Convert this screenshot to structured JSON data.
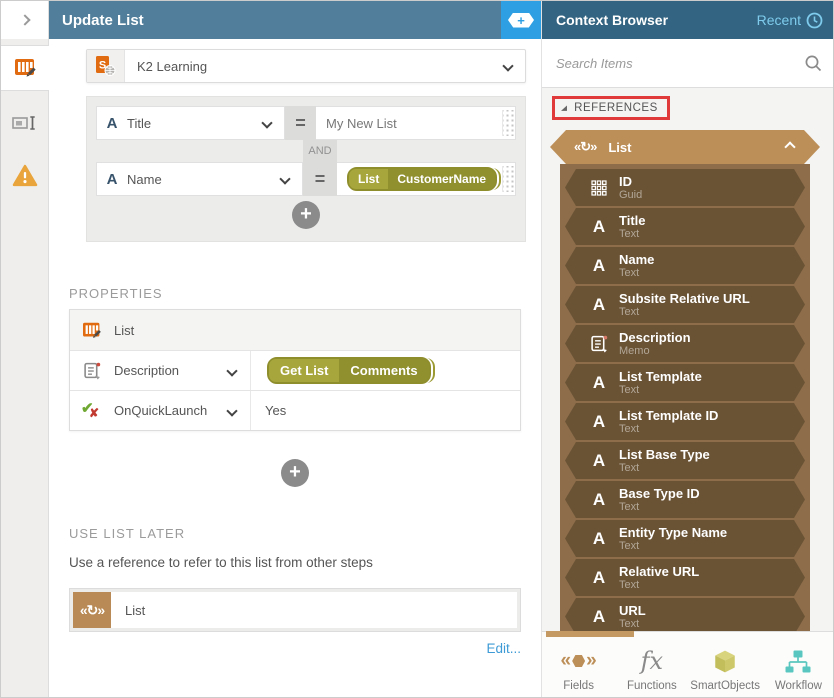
{
  "icon_glyphs": {
    "text_field": "A",
    "reference": "«↻»",
    "plus": "+",
    "fx": "fx",
    "expander": "◢",
    "smartobject_letter": "S"
  },
  "colors": {
    "main_header": "#517f9b",
    "context_header": "#336481",
    "accent_blue": "#2d9fe2",
    "link_blue": "#3e9bd6",
    "recent_blue": "#7ecbed",
    "reference_tan": "#bd8f58",
    "reference_body_brown": "#8d6d4a",
    "reference_item_brown": "#6a5335",
    "token_olive_light": "#a7a63c",
    "token_olive_dark": "#90902f",
    "orange_icon": "#e06b10",
    "warning_orange": "#e9a43b",
    "annotation_red": "#e03a3a",
    "workflow_teal": "#59c7bf",
    "smartobject_olive": "#c9c567"
  },
  "main": {
    "header": {
      "title": "Update List"
    },
    "smartobject_selector": {
      "value": "K2 Learning"
    },
    "conditions": {
      "conjunction": "AND",
      "rows": [
        {
          "field": "Title",
          "operator": "=",
          "value": "My New List"
        },
        {
          "field": "Name",
          "operator": "=",
          "token": {
            "segments": [
              "List",
              "CustomerName"
            ]
          }
        }
      ]
    },
    "properties": {
      "heading": "PROPERTIES",
      "rows": [
        {
          "label": "List"
        },
        {
          "label": "Description",
          "token": {
            "segments": [
              "Get List",
              "Comments"
            ]
          }
        },
        {
          "label": "OnQuickLaunch",
          "value": "Yes"
        }
      ]
    },
    "use_list_later": {
      "heading": "USE LIST LATER",
      "description": "Use a reference to refer to this list from other steps",
      "reference_label": "List",
      "edit_link": "Edit..."
    }
  },
  "context_browser": {
    "title": "Context Browser",
    "recent_label": "Recent",
    "search_placeholder": "Search Items",
    "references": {
      "section_label": "REFERENCES",
      "group": {
        "label": "List",
        "fields": [
          {
            "label": "ID",
            "type": "Guid"
          },
          {
            "label": "Title",
            "type": "Text"
          },
          {
            "label": "Name",
            "type": "Text"
          },
          {
            "label": "Subsite Relative URL",
            "type": "Text"
          },
          {
            "label": "Description",
            "type": "Memo"
          },
          {
            "label": "List Template",
            "type": "Text"
          },
          {
            "label": "List Template ID",
            "type": "Text"
          },
          {
            "label": "List Base Type",
            "type": "Text"
          },
          {
            "label": "Base Type ID",
            "type": "Text"
          },
          {
            "label": "Entity Type Name",
            "type": "Text"
          },
          {
            "label": "Relative URL",
            "type": "Text"
          },
          {
            "label": "URL",
            "type": "Text"
          }
        ]
      }
    },
    "toolbar": {
      "tabs": [
        {
          "label": "Fields"
        },
        {
          "label": "Functions"
        },
        {
          "label": "SmartObjects"
        },
        {
          "label": "Workflow"
        }
      ]
    }
  }
}
